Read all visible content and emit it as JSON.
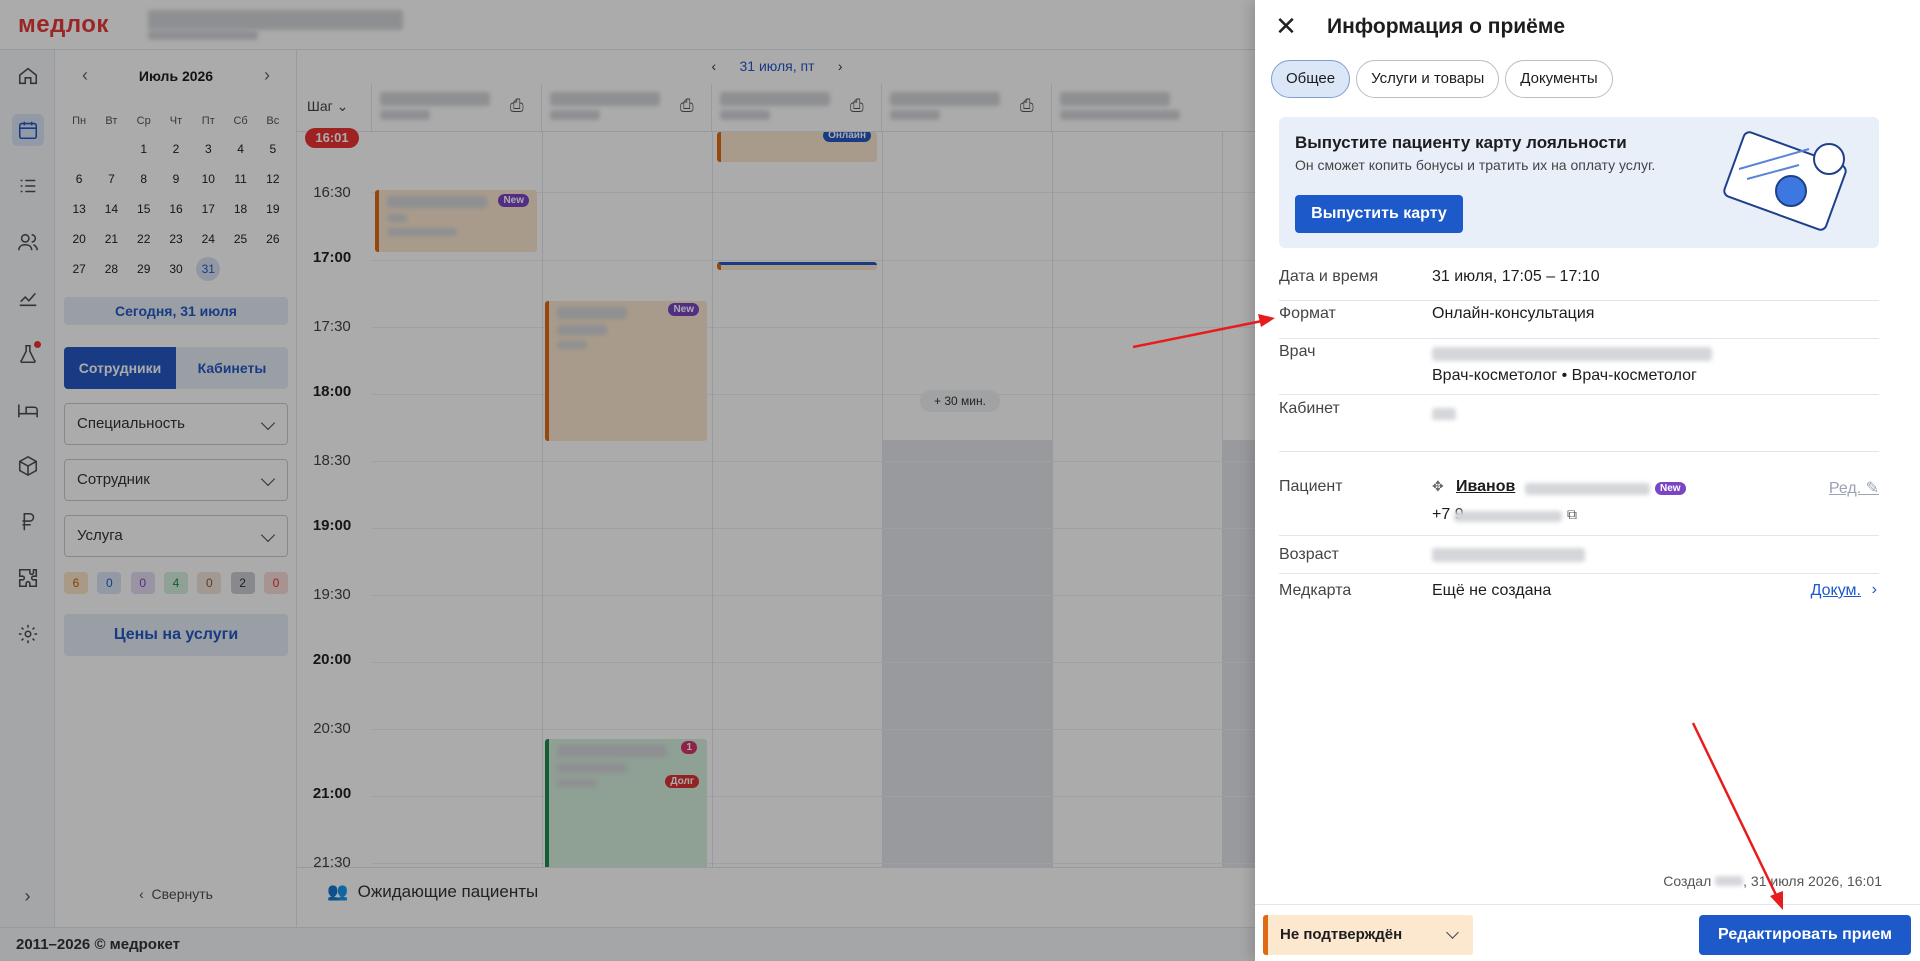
{
  "app": {
    "logo": "медлок"
  },
  "calendar": {
    "month": "Июль 2026",
    "weekdays": [
      "Пн",
      "Вт",
      "Ср",
      "Чт",
      "Пт",
      "Сб",
      "Вс"
    ],
    "weeks": [
      [
        "",
        "",
        "1",
        "2",
        "3",
        "4",
        "5"
      ],
      [
        "6",
        "7",
        "8",
        "9",
        "10",
        "11",
        "12"
      ],
      [
        "13",
        "14",
        "15",
        "16",
        "17",
        "18",
        "19"
      ],
      [
        "20",
        "21",
        "22",
        "23",
        "24",
        "25",
        "26"
      ],
      [
        "27",
        "28",
        "29",
        "30",
        "31",
        "",
        ""
      ]
    ],
    "selected_day": "31",
    "today_button": "Сегодня, 31 июля"
  },
  "sidebar": {
    "seg_staff": "Сотрудники",
    "seg_rooms": "Кабинеты",
    "filter_specialty": "Специальность",
    "filter_staff": "Сотрудник",
    "filter_service": "Услуга",
    "counters": [
      "6",
      "0",
      "0",
      "4",
      "0",
      "2",
      "0"
    ],
    "prices_button": "Цены на услуги",
    "collapse": "Свернуть"
  },
  "schedule": {
    "date_label": "31 июля, пт",
    "step_label": "Шаг",
    "current_time": "16:01",
    "times": [
      "16:30",
      "17:00",
      "17:30",
      "18:00",
      "18:30",
      "19:00",
      "19:30",
      "20:00",
      "20:30",
      "21:00",
      "21:30"
    ],
    "hour_marks": [
      "17:00",
      "18:00",
      "19:00",
      "20:00",
      "21:00"
    ],
    "more_label": "+ 30 мин.",
    "badge_new": "New",
    "badge_online": "Онлайн",
    "badge_debt": "Долг",
    "badge_count": "1",
    "waiting": "Ожидающие пациенты"
  },
  "footer": {
    "years": "2011–2026",
    "brand": "© медрокет"
  },
  "panel": {
    "title": "Информация о приёме",
    "tabs": [
      "Общее",
      "Услуги и товары",
      "Документы"
    ],
    "promo_title": "Выпустите пациенту карту лояльности",
    "promo_text": "Он сможет копить бонусы и тратить их на оплату услуг.",
    "promo_button": "Выпустить карту",
    "date_label": "Дата и время",
    "date_value": "31 июля, 17:05 – 17:10",
    "format_label": "Формат",
    "format_value": "Онлайн-консультация",
    "doctor_label": "Врач",
    "doctor_spec": "Врач-косметолог • Врач-косметолог",
    "room_label": "Кабинет",
    "patient_label": "Пациент",
    "patient_name": "Иванов",
    "patient_badge": "New",
    "patient_phone": "+7 9",
    "edit_link": "Ред.",
    "age_label": "Возраст",
    "card_label": "Медкарта",
    "card_value": "Ещё не создана",
    "docs_link": "Докум.",
    "created_prefix": "Создал",
    "created_date": ", 31 июля 2026, 16:01",
    "status": "Не подтверждён",
    "edit_button": "Редактировать прием"
  }
}
